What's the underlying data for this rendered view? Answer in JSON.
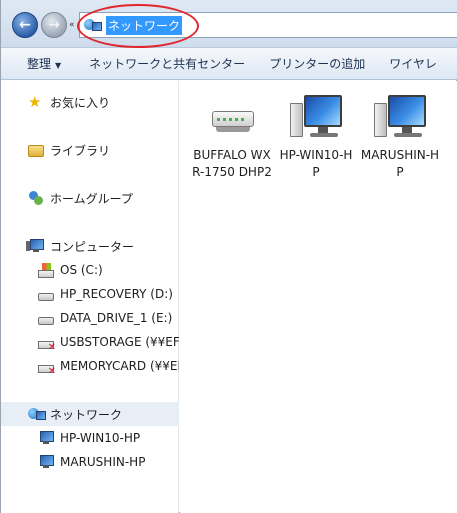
{
  "address_bar": {
    "location": "ネットワーク",
    "history_glyph": "«"
  },
  "toolbar": {
    "organize": "整理",
    "network_sharing_center": "ネットワークと共有センター",
    "add_printer": "プリンターの追加",
    "wireless": "ワイヤレ"
  },
  "nav": {
    "favorites": "お気に入り",
    "libraries": "ライブラリ",
    "homegroup": "ホームグループ",
    "computer": "コンピューター",
    "drives": [
      {
        "label": "OS (C:)",
        "icon": "os-drive-icon"
      },
      {
        "label": "HP_RECOVERY (D:)",
        "icon": "drive-icon"
      },
      {
        "label": "DATA_DRIVE_1 (E:)",
        "icon": "drive-icon"
      },
      {
        "label": "USBSTORAGE (¥¥EF",
        "icon": "disconnected-drive-icon"
      },
      {
        "label": "MEMORYCARD (¥¥EI",
        "icon": "disconnected-drive-icon"
      }
    ],
    "network": "ネットワーク",
    "network_children": [
      {
        "label": "HP-WIN10-HP"
      },
      {
        "label": "MARUSHIN-HP"
      }
    ]
  },
  "content": {
    "items": [
      {
        "label": "BUFFALO WXR-1750 DHP2",
        "icon": "router-icon"
      },
      {
        "label": "HP-WIN10-HP",
        "icon": "computer-icon"
      },
      {
        "label": "MARUSHIN-HP",
        "icon": "computer-icon"
      }
    ]
  },
  "colors": {
    "selection": "#3399ff",
    "annotation": "#e0262b"
  }
}
